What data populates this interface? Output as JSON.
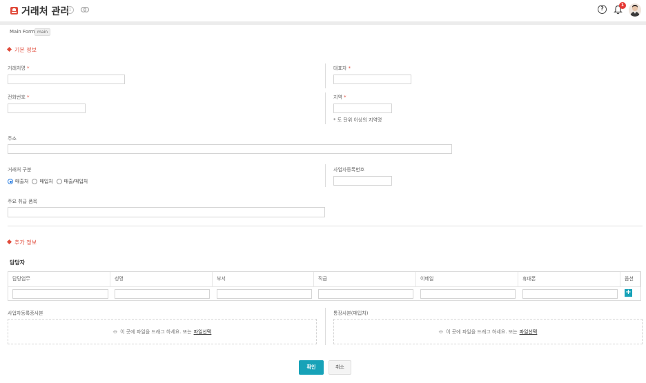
{
  "header": {
    "title": "거래처 관리",
    "info_icon": "info-icon",
    "link_icon": "link-icon",
    "help_icon": "help-icon",
    "bell_icon": "bell-icon",
    "notification_count": "1",
    "avatar": "user-avatar"
  },
  "form": {
    "name": "Main Form",
    "badge": "main"
  },
  "basic_section": {
    "title": "기본 정보",
    "fields": {
      "company_name": {
        "label": "거래처명",
        "required": "*",
        "value": ""
      },
      "representative": {
        "label": "대표자",
        "required": "*",
        "value": ""
      },
      "phone": {
        "label": "전화번호",
        "required": "*",
        "value": ""
      },
      "region": {
        "label": "지역",
        "required": "*",
        "value": "",
        "hint": "* 도 단위 이상의 지역명"
      },
      "address": {
        "label": "주소",
        "value": ""
      },
      "partner_type": {
        "label": "거래처 구분",
        "options": [
          "매출처",
          "매입처",
          "매출/매입처"
        ],
        "selected": "매출처"
      },
      "business_number": {
        "label": "사업자등록번호",
        "value": ""
      },
      "main_items": {
        "label": "주요 취급 품목",
        "value": ""
      }
    }
  },
  "extra_section": {
    "title": "추가 정보",
    "contacts": {
      "heading": "담당자",
      "columns": [
        "담당업무",
        "성명",
        "부서",
        "직급",
        "이메일",
        "휴대폰",
        "옵션"
      ],
      "add_label": "+"
    },
    "uploads": [
      {
        "label": "사업자등록증사본",
        "drop_text": "이 곳에 파일을 드래그 하세요. 또는",
        "pick_label": "파일선택"
      },
      {
        "label": "통장사본(매입처)",
        "drop_text": "이 곳에 파일을 드래그 하세요. 또는",
        "pick_label": "파일선택"
      }
    ]
  },
  "actions": {
    "confirm_label": "확인",
    "cancel_label": "취소"
  },
  "colors": {
    "accent": "#17a2b8",
    "section_title": "#e04a3a",
    "required": "#e04a3a",
    "badge": "#e53935"
  }
}
